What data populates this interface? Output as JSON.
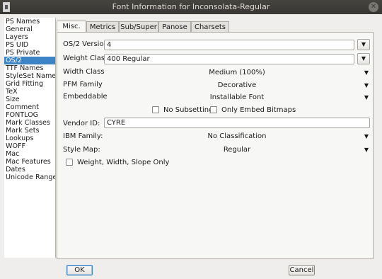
{
  "window": {
    "title": "Font Information for Inconsolata-Regular",
    "close_glyph": "✕"
  },
  "sidebar": {
    "items": [
      {
        "label": "PS Names"
      },
      {
        "label": "General"
      },
      {
        "label": "Layers"
      },
      {
        "label": "PS UID"
      },
      {
        "label": "PS Private"
      },
      {
        "label": "OS/2"
      },
      {
        "label": "TTF Names"
      },
      {
        "label": "StyleSet Names"
      },
      {
        "label": "Grid Fitting"
      },
      {
        "label": "TeX"
      },
      {
        "label": "Size"
      },
      {
        "label": "Comment"
      },
      {
        "label": "FONTLOG"
      },
      {
        "label": "Mark Classes"
      },
      {
        "label": "Mark Sets"
      },
      {
        "label": "Lookups"
      },
      {
        "label": "WOFF"
      },
      {
        "label": "Mac"
      },
      {
        "label": "Mac Features"
      },
      {
        "label": "Dates"
      },
      {
        "label": "Unicode Ranges"
      }
    ],
    "selected": "OS/2"
  },
  "tabs": [
    {
      "label": "Misc."
    },
    {
      "label": "Metrics"
    },
    {
      "label": "Sub/Super"
    },
    {
      "label": "Panose"
    },
    {
      "label": "Charsets"
    }
  ],
  "active_tab": "Misc.",
  "form": {
    "os2_version": {
      "label": "OS/2 Version",
      "value": "4"
    },
    "weight_class": {
      "label": "Weight Class",
      "value": "400 Regular"
    },
    "width_class": {
      "label": "Width Class",
      "value": "Medium (100%)"
    },
    "pfm_family": {
      "label": "PFM Family",
      "value": "Decorative"
    },
    "embeddable": {
      "label": "Embeddable",
      "value": "Installable Font"
    },
    "no_subsetting": {
      "label": "No Subsetting",
      "checked": false
    },
    "only_embed_bitmaps": {
      "label": "Only Embed Bitmaps",
      "checked": false
    },
    "vendor_id": {
      "label": "Vendor ID:",
      "value": "CYRE"
    },
    "ibm_family": {
      "label": "IBM Family:",
      "value": "No Classification"
    },
    "style_map": {
      "label": "Style Map:",
      "value": "Regular"
    },
    "weight_width_slope": {
      "label": "Weight, Width, Slope Only",
      "checked": false
    }
  },
  "icons": {
    "dropdown": "chevron-down-icon",
    "arrow_glyph": "▼"
  },
  "buttons": {
    "ok": "OK",
    "cancel": "Cancel"
  }
}
